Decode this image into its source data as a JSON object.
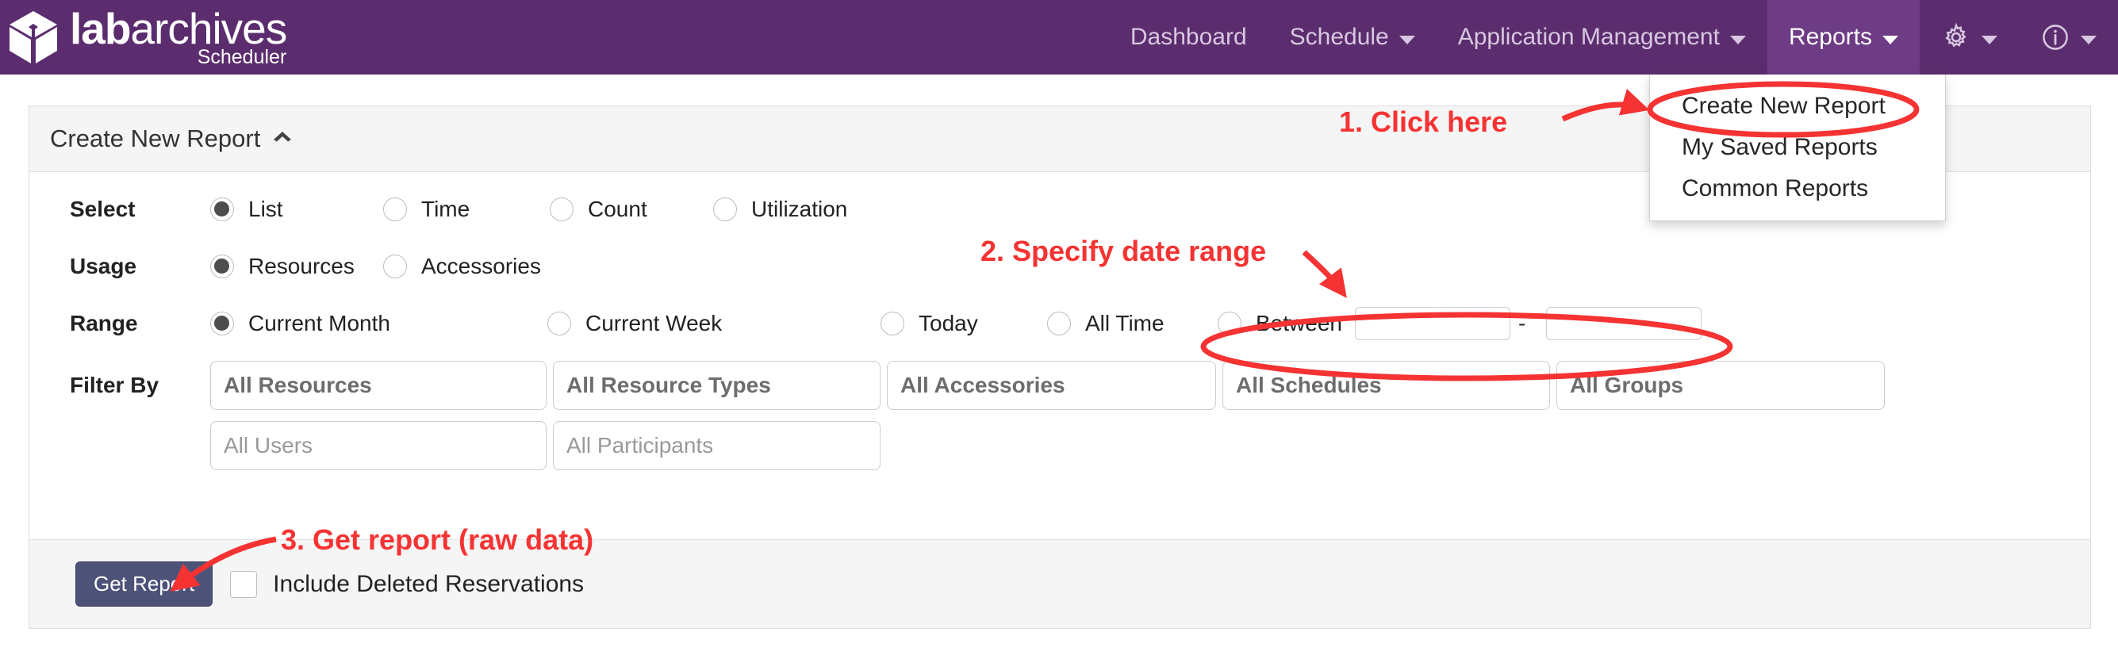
{
  "brand": {
    "word_bold": "lab",
    "word_light": "archives",
    "subtitle": "Scheduler",
    "icon": "cube-icon"
  },
  "topbar": {
    "background": "#5b2d6e",
    "active_background": "#6e3b85",
    "items": [
      {
        "label": "Dashboard",
        "has_caret": false,
        "active": false
      },
      {
        "label": "Schedule",
        "has_caret": true,
        "active": false
      },
      {
        "label": "Application Management",
        "has_caret": true,
        "active": false
      },
      {
        "label": "Reports",
        "has_caret": true,
        "active": true
      }
    ],
    "icon_items": [
      {
        "icon": "gear-icon",
        "has_caret": true
      },
      {
        "icon": "info-icon",
        "has_caret": true
      }
    ]
  },
  "reports_menu": {
    "items": [
      "Create New Report",
      "My Saved Reports",
      "Common Reports"
    ]
  },
  "card": {
    "header_title": "Create New Report",
    "header_toggle_icon": "chevron-up-icon",
    "rows": [
      {
        "label": "Select",
        "options": [
          {
            "label": "List",
            "checked": true
          },
          {
            "label": "Time",
            "checked": false
          },
          {
            "label": "Count",
            "checked": false
          },
          {
            "label": "Utilization",
            "checked": false
          }
        ]
      },
      {
        "label": "Usage",
        "options": [
          {
            "label": "Resources",
            "checked": true
          },
          {
            "label": "Accessories",
            "checked": false
          }
        ]
      },
      {
        "label": "Range",
        "options": [
          {
            "label": "Current Month",
            "checked": true
          },
          {
            "label": "Current Week",
            "checked": false
          },
          {
            "label": "Today",
            "checked": false
          },
          {
            "label": "All Time",
            "checked": false
          },
          {
            "label": "Between",
            "checked": false
          }
        ],
        "between": {
          "start_value": "",
          "end_value": "",
          "separator": "-"
        }
      }
    ],
    "filter_label": "Filter By",
    "filters_row1": [
      {
        "text": "All Resources",
        "style": "value"
      },
      {
        "text": "All Resource Types",
        "style": "value"
      },
      {
        "text": "All Accessories",
        "style": "value"
      },
      {
        "text": "All Schedules",
        "style": "value"
      },
      {
        "text": "All Groups",
        "style": "value"
      }
    ],
    "filters_row2": [
      {
        "text": "All Users",
        "style": "placeholder"
      },
      {
        "text": "All Participants",
        "style": "placeholder"
      }
    ],
    "footer": {
      "get_report_label": "Get Report",
      "get_report_color": "#4d5278",
      "include_deleted_label": "Include Deleted Reservations",
      "include_deleted_checked": false
    }
  },
  "annotations": {
    "color": "#f53333",
    "step1": "1. Click here",
    "step2": "2. Specify date range",
    "step3": "3. Get report (raw data)"
  }
}
